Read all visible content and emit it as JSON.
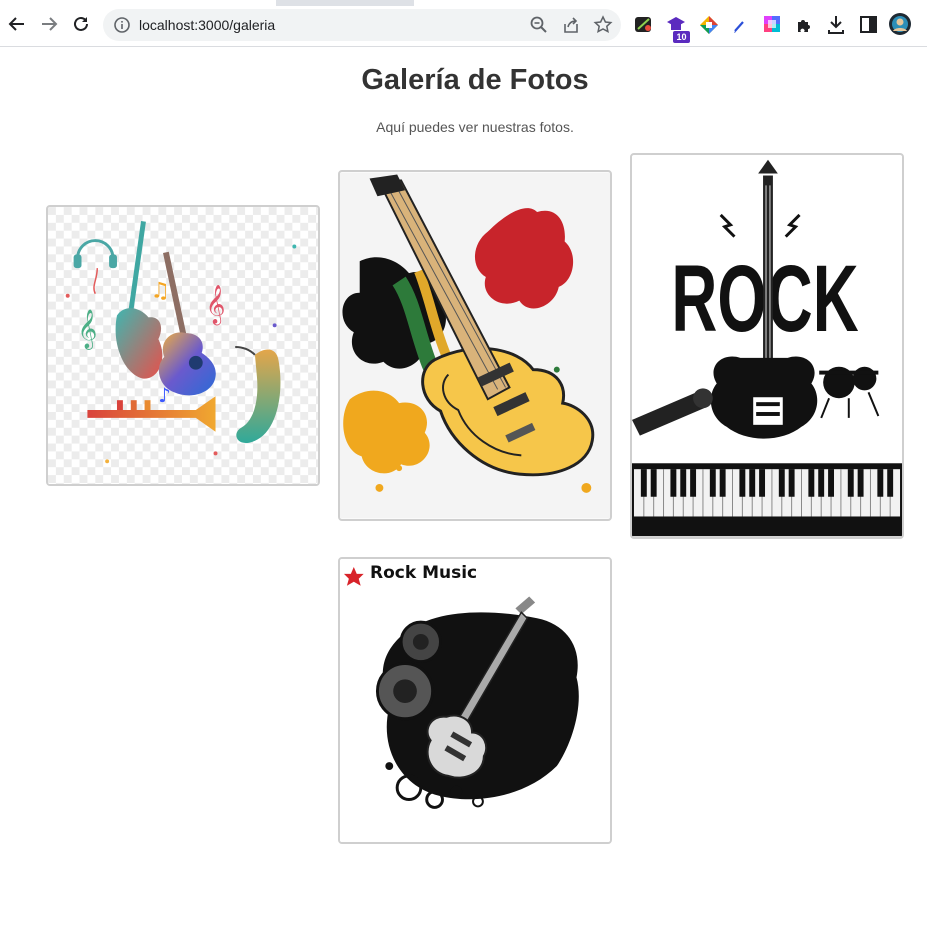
{
  "browser": {
    "url": "localhost:3000/galeria",
    "extension_icons": [
      "puzzle-game-icon",
      "school-badge-icon",
      "color-picker-icon",
      "pen-icon",
      "gradient-icon",
      "extensions-puzzle-icon",
      "download-icon",
      "sidebar-icon",
      "profile-avatar-icon"
    ],
    "badge_count": "10"
  },
  "page": {
    "title": "Galería de Fotos",
    "subtitle": "Aquí puedes ver nuestras fotos."
  },
  "gallery": {
    "photo4_caption": "Rock Music",
    "photo3_word": "ROCK"
  },
  "colors": {
    "title": "#333333",
    "border": "#cfcfcf",
    "badge": "#5b2bbf"
  }
}
